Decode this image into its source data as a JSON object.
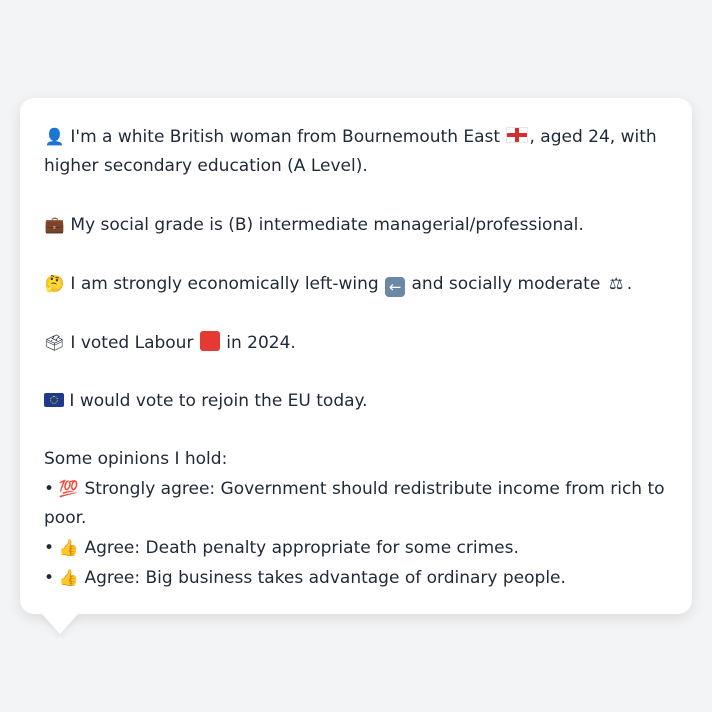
{
  "profile": {
    "identity_text_1": "I'm a white British woman from Bournemouth East",
    "identity_text_2": ", aged 24, with higher secondary education (A Level).",
    "identity_icon": "person-silhouette-icon",
    "region_flag_icon": "england-flag-icon",
    "social_grade": "My social grade is (B) intermediate managerial/professional.",
    "social_grade_icon": "briefcase-icon",
    "political_text_1": "I am strongly economically left-wing",
    "political_text_2": "and socially moderate",
    "political_icon": "thinking-face-icon",
    "left_icon": "left-arrow-icon",
    "moderate_icon": "balance-scale-icon",
    "vote_text_1": "I voted Labour",
    "vote_text_2": "in 2024.",
    "vote_icon": "ballot-box-icon",
    "party_color_icon": "red-square-icon",
    "party_color": "#e53935",
    "eu_text": "I would vote to rejoin the EU today.",
    "eu_icon": "eu-flag-icon"
  },
  "opinions": {
    "heading": "Some opinions I hold:",
    "items": [
      {
        "bullet": "•",
        "icon": "hundred-points-icon",
        "glyph": "💯",
        "text": "Strongly agree: Government should redistribute income from rich to poor."
      },
      {
        "bullet": "•",
        "icon": "thumbs-up-icon",
        "glyph": "👍",
        "text": "Agree: Death penalty appropriate for some crimes."
      },
      {
        "bullet": "•",
        "icon": "thumbs-up-icon",
        "glyph": "👍",
        "text": "Agree: Big business takes advantage of ordinary people."
      }
    ]
  }
}
